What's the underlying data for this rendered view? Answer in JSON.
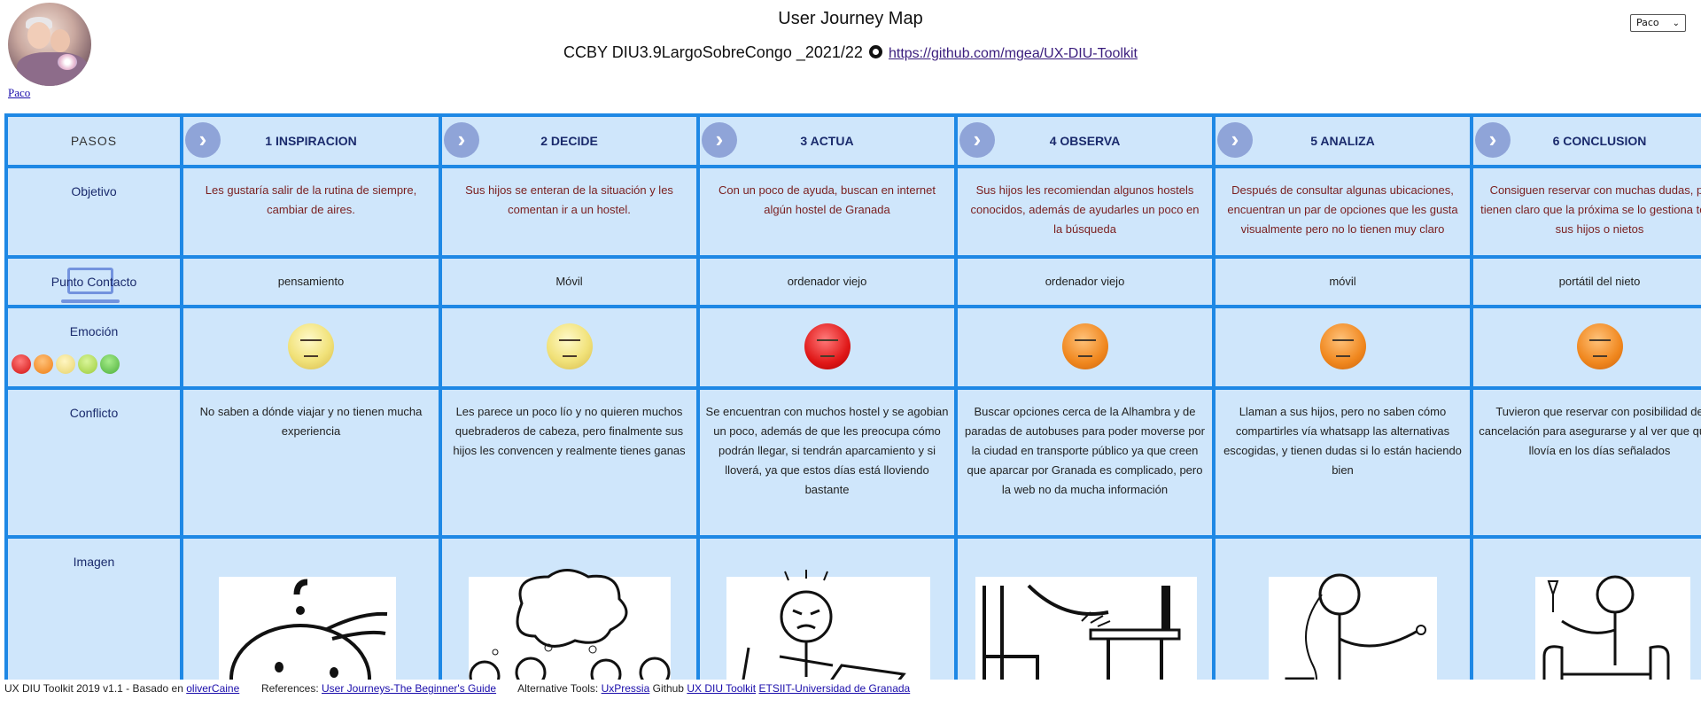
{
  "header": {
    "title": "User Journey Map",
    "subtitle_text": "CCBY DIU3.9LargoSobreCongo _2021/22",
    "repo_link": "https://github.com/mgea/UX-DIU-Toolkit",
    "persona_link": "Paco",
    "persona_select": "Paco"
  },
  "steps": [
    {
      "number_label": "1 INSPIRACION"
    },
    {
      "number_label": "2 DECIDE"
    },
    {
      "number_label": "3 ACTUA"
    },
    {
      "number_label": "4 OBSERVA"
    },
    {
      "number_label": "5 ANALIZA"
    },
    {
      "number_label": "6 CONCLUSION"
    }
  ],
  "row_labels": {
    "steps": "PASOS",
    "goal": "Objetivo",
    "contact": "Punto Contacto",
    "emotion": "Emoción",
    "conflict": "Conflicto",
    "image": "Imagen"
  },
  "goals": [
    "Les gustaría salir de la rutina de siempre, cambiar de aires.",
    "Sus hijos se enteran de la situación y les comentan ir a un hostel.",
    "Con un poco de ayuda, buscan en internet algún hostel de Granada",
    "Sus hijos les recomiendan algunos hostels conocidos, además de ayudarles un poco en la búsqueda",
    "Después de consultar algunas ubicaciones, encuentran un par de opciones que les gusta visualmente pero no lo tienen muy claro",
    "Consiguen reservar con muchas dudas, pe tienen claro que la próxima se lo gestiona todo sus hijos o nietos"
  ],
  "contacts": [
    "pensamiento",
    "Móvil",
    "ordenador viejo",
    "ordenador viejo",
    "móvil",
    "portátil del nieto"
  ],
  "emotions": [
    "neutral",
    "neutral",
    "angry",
    "annoyed",
    "annoyed",
    "annoyed"
  ],
  "conflicts": [
    "No saben a dónde viajar y no tienen mucha experiencia",
    "Les parece un poco lío y no quieren muchos quebraderos de cabeza, pero finalmente sus hijos les convencen y realmente tienes ganas",
    "Se encuentran con muchos hostel y se agobian un poco, además de que les preocupa cómo podrán llegar, si tendrán aparcamiento y si lloverá, ya que estos días está lloviendo bastante",
    "Buscar opciones cerca de la Alhambra y de paradas de autobuses para poder moverse por la ciudad en transporte público ya que creen que aparcar por Granada es complicado, pero la web no da mucha información",
    "Llaman a sus hijos, pero no saben cómo compartirles vía whatsapp las alternativas escogidas, y tienen dudas si lo están haciendo bien",
    "Tuvieron que reservar con posibilidad de cancelación para asegurarse y al ver que quizá llovía en los días señalados"
  ],
  "colors": {
    "grid_border": "#1e88e5",
    "cell_bg": "#cfe6fb",
    "goal_text": "#7a1e1e",
    "arrow_bg": "#8fa4d8"
  },
  "footer": {
    "credit": "UX DIU Toolkit 2019 v1.1 - Basado en",
    "credit_link": "oliverCaine",
    "refs_label": "References:",
    "refs_link": "User Journeys-The Beginner's Guide",
    "alt_label": "Alternative Tools:",
    "alt_link": "UxPressia",
    "github_label": "Github",
    "github_link": "UX DIU Toolkit",
    "etsiit_link": "ETSIIT-Universidad de Granada"
  }
}
